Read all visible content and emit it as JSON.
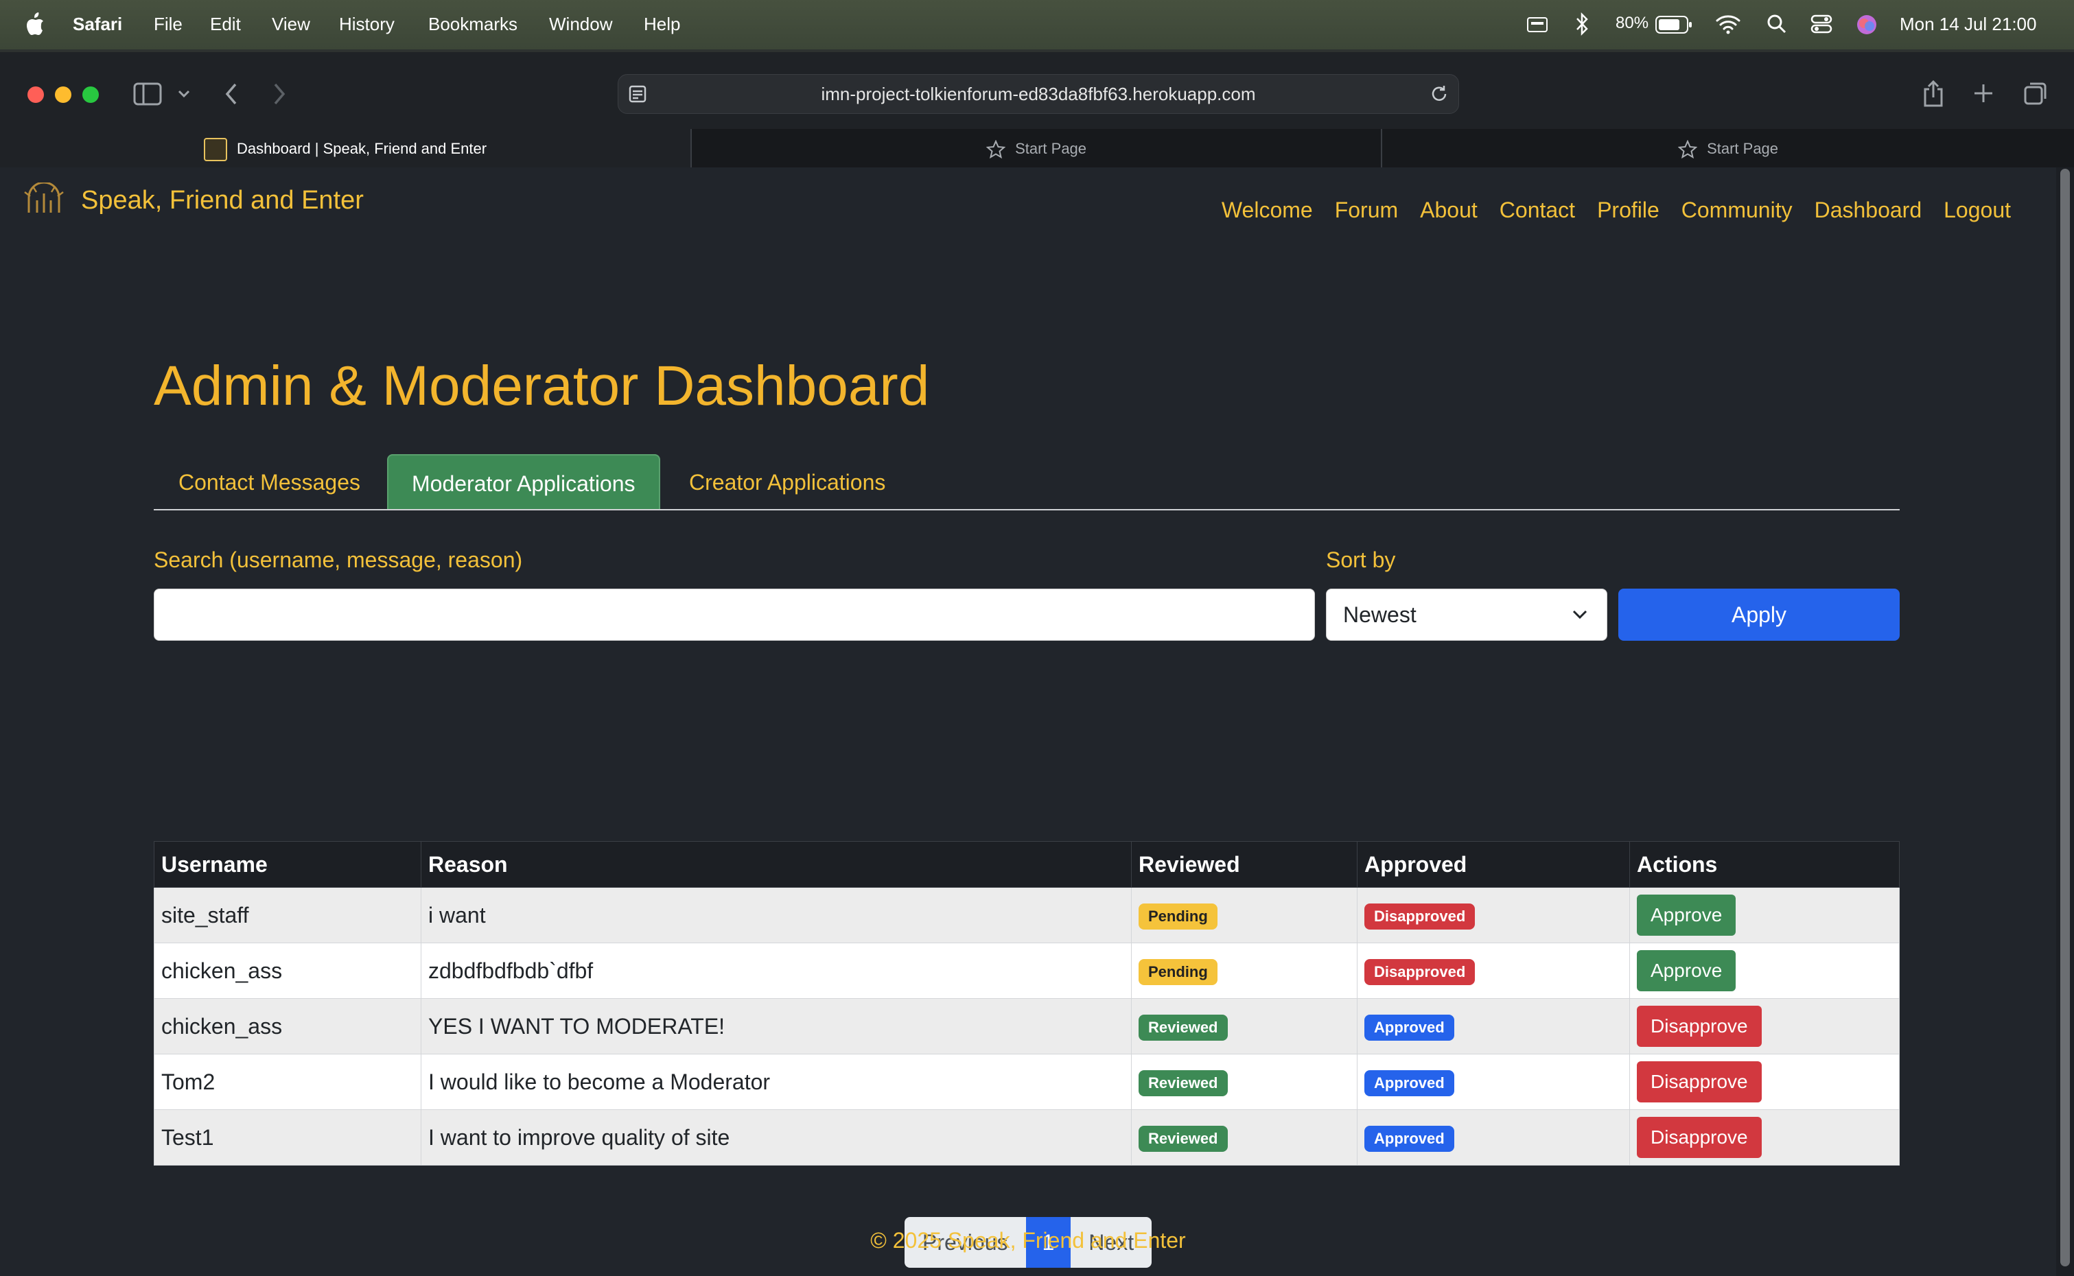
{
  "menubar": {
    "app": "Safari",
    "items": [
      "File",
      "Edit",
      "View",
      "History",
      "Bookmarks",
      "Window",
      "Help"
    ],
    "battery": "80%",
    "datetime": "Mon 14 Jul  21:00"
  },
  "browser": {
    "url": "imn-project-tolkienforum-ed83da8fbf63.herokuapp.com",
    "tabs": [
      {
        "label": "Dashboard | Speak, Friend and Enter"
      },
      {
        "label": "Start Page"
      },
      {
        "label": "Start Page"
      }
    ]
  },
  "site": {
    "brand": "Speak, Friend and Enter",
    "nav": [
      "Welcome",
      "Forum",
      "About",
      "Contact",
      "Profile",
      "Community",
      "Dashboard",
      "Logout"
    ]
  },
  "dashboard": {
    "title": "Admin & Moderator Dashboard",
    "tabs": [
      "Contact Messages",
      "Moderator Applications",
      "Creator Applications"
    ],
    "search_label": "Search (username, message, reason)",
    "search_value": "",
    "sort_label": "Sort by",
    "sort_value": "Newest",
    "apply_label": "Apply"
  },
  "table": {
    "headers": [
      "Username",
      "Reason",
      "Reviewed",
      "Approved",
      "Actions"
    ],
    "rows": [
      {
        "username": "site_staff",
        "reason": "i want",
        "reviewed": "Pending",
        "approved": "Disapproved",
        "action": "Approve"
      },
      {
        "username": "chicken_ass",
        "reason": "zdbdfbdfbdb`dfbf",
        "reviewed": "Pending",
        "approved": "Disapproved",
        "action": "Approve"
      },
      {
        "username": "chicken_ass",
        "reason": "YES I WANT TO MODERATE!",
        "reviewed": "Reviewed",
        "approved": "Approved",
        "action": "Disapprove"
      },
      {
        "username": "Tom2",
        "reason": "I would like to become a Moderator",
        "reviewed": "Reviewed",
        "approved": "Approved",
        "action": "Disapprove"
      },
      {
        "username": "Test1",
        "reason": "I want to improve quality of site",
        "reviewed": "Reviewed",
        "approved": "Approved",
        "action": "Disapprove"
      }
    ]
  },
  "pagination": {
    "previous": "Previous",
    "current": "1",
    "next": "Next"
  },
  "footer": "© 2025 Speak, Friend and Enter",
  "colors": {
    "accent": "#f3c13a",
    "page_bg": "#21252b",
    "primary": "#2563eb",
    "success": "#3d8a55",
    "danger": "#d2383f",
    "warning": "#f5c33b"
  }
}
